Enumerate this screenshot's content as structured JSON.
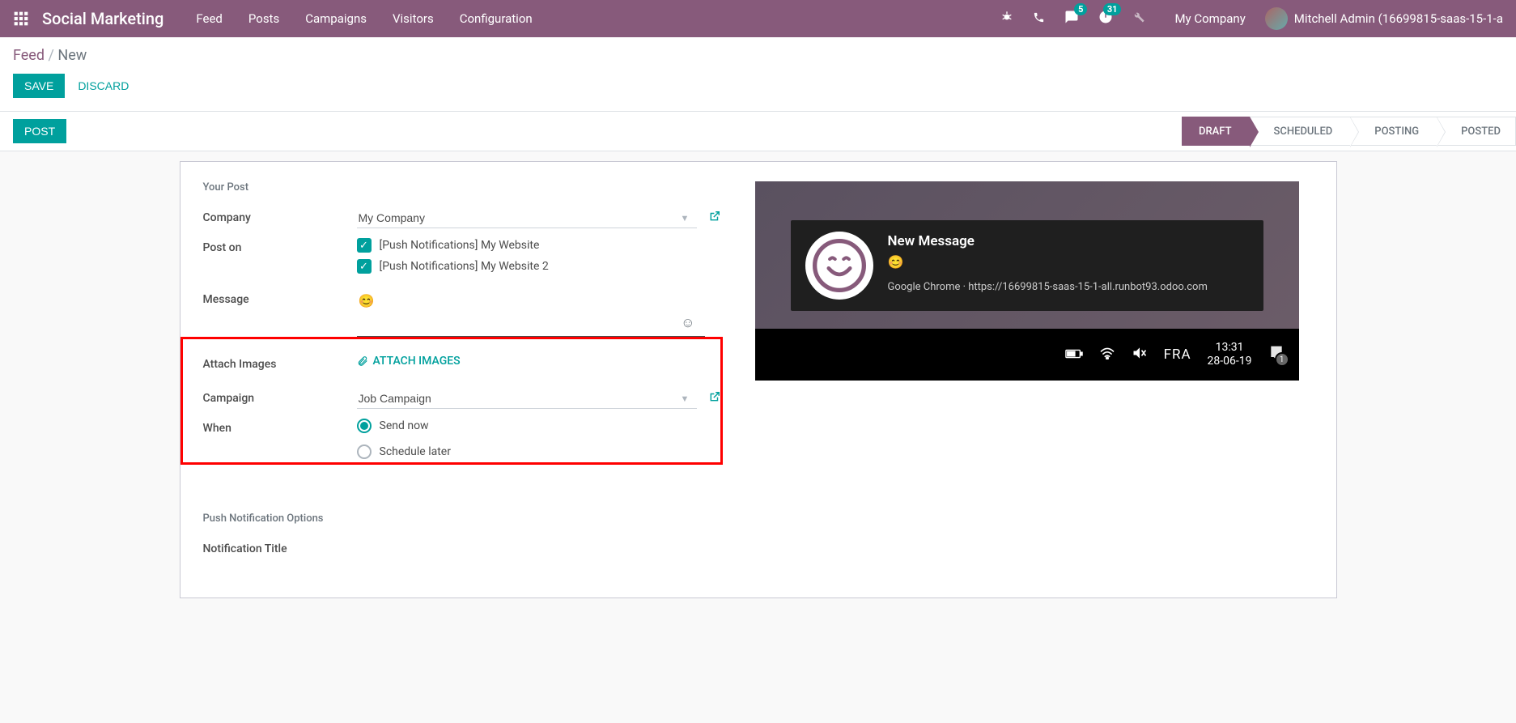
{
  "navbar": {
    "brand": "Social Marketing",
    "items": [
      "Feed",
      "Posts",
      "Campaigns",
      "Visitors",
      "Configuration"
    ],
    "messages_badge": "5",
    "activities_badge": "31",
    "company": "My Company",
    "user": "Mitchell Admin (16699815-saas-15-1-a"
  },
  "breadcrumb": {
    "parent": "Feed",
    "sep": "/",
    "current": "New"
  },
  "buttons": {
    "save": "SAVE",
    "discard": "DISCARD",
    "post": "POST"
  },
  "statusbar": [
    "DRAFT",
    "SCHEDULED",
    "POSTING",
    "POSTED"
  ],
  "form": {
    "section1": "Your Post",
    "labels": {
      "company": "Company",
      "post_on": "Post on",
      "message": "Message",
      "attach": "Attach Images",
      "campaign": "Campaign",
      "when": "When"
    },
    "company_value": "My Company",
    "post_on": [
      "[Push Notifications] My Website",
      "[Push Notifications] My Website 2"
    ],
    "message_value": "😊",
    "attach_button": "ATTACH IMAGES",
    "campaign_value": "Job Campaign",
    "when_options": {
      "now": "Send now",
      "later": "Schedule later"
    },
    "section2": "Push Notification Options",
    "notif_title_label": "Notification Title"
  },
  "preview": {
    "title": "New Message",
    "message": "😊",
    "source": "Google Chrome · https://16699815-saas-15-1-all.runbot93.odoo.com",
    "tray": {
      "lang": "FRA",
      "time": "13:31",
      "date": "28-06-19",
      "notif_count": "1"
    }
  }
}
